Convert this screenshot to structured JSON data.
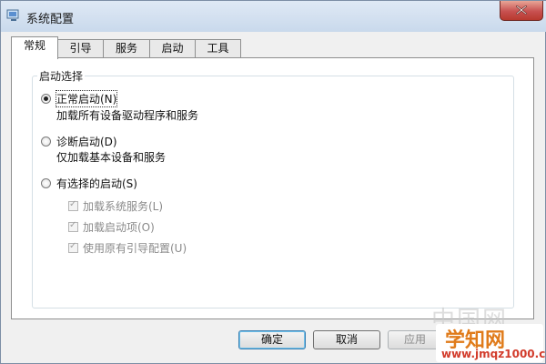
{
  "window": {
    "title": "系统配置"
  },
  "tabs": [
    {
      "label": "常规",
      "active": true
    },
    {
      "label": "引导",
      "active": false
    },
    {
      "label": "服务",
      "active": false
    },
    {
      "label": "启动",
      "active": false
    },
    {
      "label": "工具",
      "active": false
    }
  ],
  "startup_group": {
    "legend": "启动选择",
    "normal": {
      "label": "正常启动(N)",
      "desc": "加载所有设备驱动程序和服务",
      "selected": true
    },
    "diagnostic": {
      "label": "诊断启动(D)",
      "desc": "仅加载基本设备和服务",
      "selected": false
    },
    "selective": {
      "label": "有选择的启动(S)",
      "selected": false,
      "options": [
        {
          "label": "加载系统服务(L)",
          "checked": true
        },
        {
          "label": "加载启动项(O)",
          "checked": true
        },
        {
          "label": "使用原有引导配置(U)",
          "checked": true
        }
      ]
    }
  },
  "buttons": {
    "ok": "确定",
    "cancel": "取消",
    "apply": "应用"
  },
  "watermark": {
    "ghost": "中国网",
    "brand": "学知网",
    "url": "www.jmqz1000.com"
  },
  "icons": {
    "app": "system-config-icon",
    "close": "close-icon"
  }
}
